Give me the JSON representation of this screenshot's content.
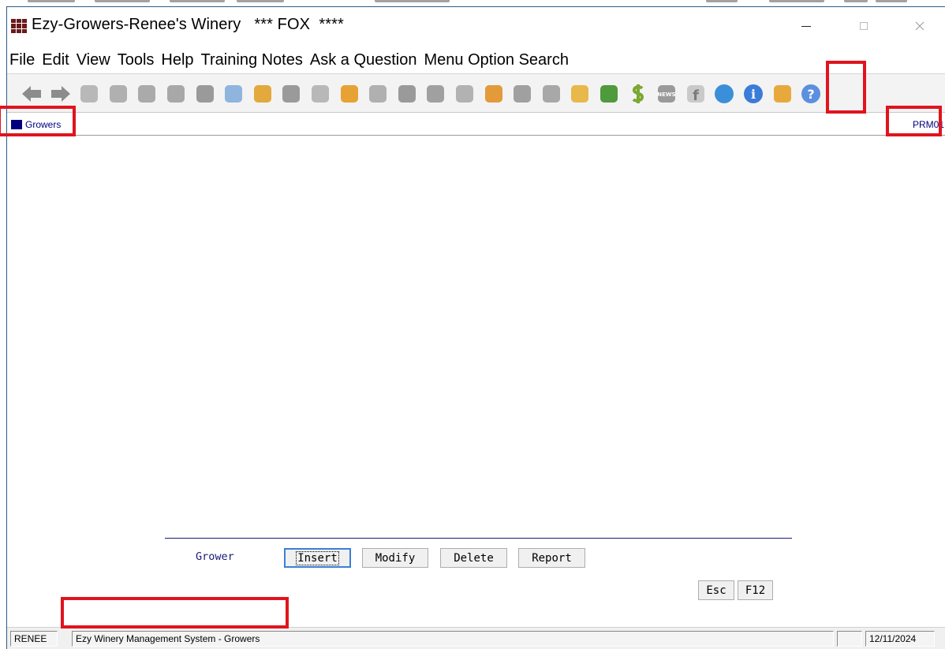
{
  "window": {
    "title": "Ezy-Growers-Renee's Winery   *** FOX  ****",
    "controls": {
      "minimize": "—",
      "maximize": "□",
      "close": "✕"
    }
  },
  "menu": [
    "File",
    "Edit",
    "View",
    "Tools",
    "Help",
    "Training Notes",
    "Ask a Question",
    "Menu Option Search"
  ],
  "toolbar": {
    "icons": [
      {
        "name": "back-arrow-icon",
        "color": "#8c8c8c"
      },
      {
        "name": "forward-arrow-icon",
        "color": "#8c8c8c"
      },
      {
        "name": "open-folder-icon",
        "color": "#b8b8b8"
      },
      {
        "name": "invoice-icon",
        "color": "#b0b0b0"
      },
      {
        "name": "payment-icon",
        "color": "#aaaaaa"
      },
      {
        "name": "bank-icon",
        "color": "#a8a8a8"
      },
      {
        "name": "ledger-icon",
        "color": "#9a9a9a"
      },
      {
        "name": "notepad-icon",
        "color": "#8fb4de"
      },
      {
        "name": "contacts-icon",
        "color": "#e3a93c"
      },
      {
        "name": "tools-icon",
        "color": "#9a9a9a"
      },
      {
        "name": "barrel-icon",
        "color": "#b8b8b8"
      },
      {
        "name": "box-icon",
        "color": "#e7a235"
      },
      {
        "name": "hose-icon",
        "color": "#b0b0b0"
      },
      {
        "name": "scale-icon",
        "color": "#9a9a9a"
      },
      {
        "name": "bottle-icon",
        "color": "#a0a0a0"
      },
      {
        "name": "grapes-icon",
        "color": "#b2b2b2"
      },
      {
        "name": "briefcase-icon",
        "color": "#e39a3a"
      },
      {
        "name": "settings-icon",
        "color": "#a0a0a0"
      },
      {
        "name": "database-icon",
        "color": "#a8a8a8"
      },
      {
        "name": "cube-icon",
        "color": "#e8b84a"
      },
      {
        "name": "vine-leaf-icon",
        "color": "#4e9a3c"
      },
      {
        "name": "dollar-icon",
        "color": "#7aa833"
      },
      {
        "name": "news-icon",
        "color": "#9a9a9a"
      },
      {
        "name": "facebook-icon",
        "color": "#c9c9c9"
      },
      {
        "name": "teamviewer-icon",
        "color": "#3a8fd8"
      },
      {
        "name": "info-icon",
        "color": "#3a7cd8"
      },
      {
        "name": "documents-icon",
        "color": "#e8a93c"
      },
      {
        "name": "help-icon",
        "color": "#5c8fe0"
      }
    ],
    "highlighted_icon": "info-icon"
  },
  "form": {
    "name": "Growers",
    "program_code": "PRM01"
  },
  "actions": {
    "group_label": "Grower",
    "buttons": {
      "insert": "Insert",
      "modify": "Modify",
      "delete": "Delete",
      "report": "Report",
      "esc": "Esc",
      "f12": "F12"
    },
    "focused": "Insert"
  },
  "statusbar": {
    "user": "RENEE",
    "message": "Ezy Winery Management System - Growers",
    "extra": "",
    "date": "12/11/2024"
  },
  "colors": {
    "accent_navy": "#00007f",
    "highlight_red": "#e0141e",
    "focus_blue": "#3c7fd6",
    "app_icon": "#6b1a1a"
  }
}
